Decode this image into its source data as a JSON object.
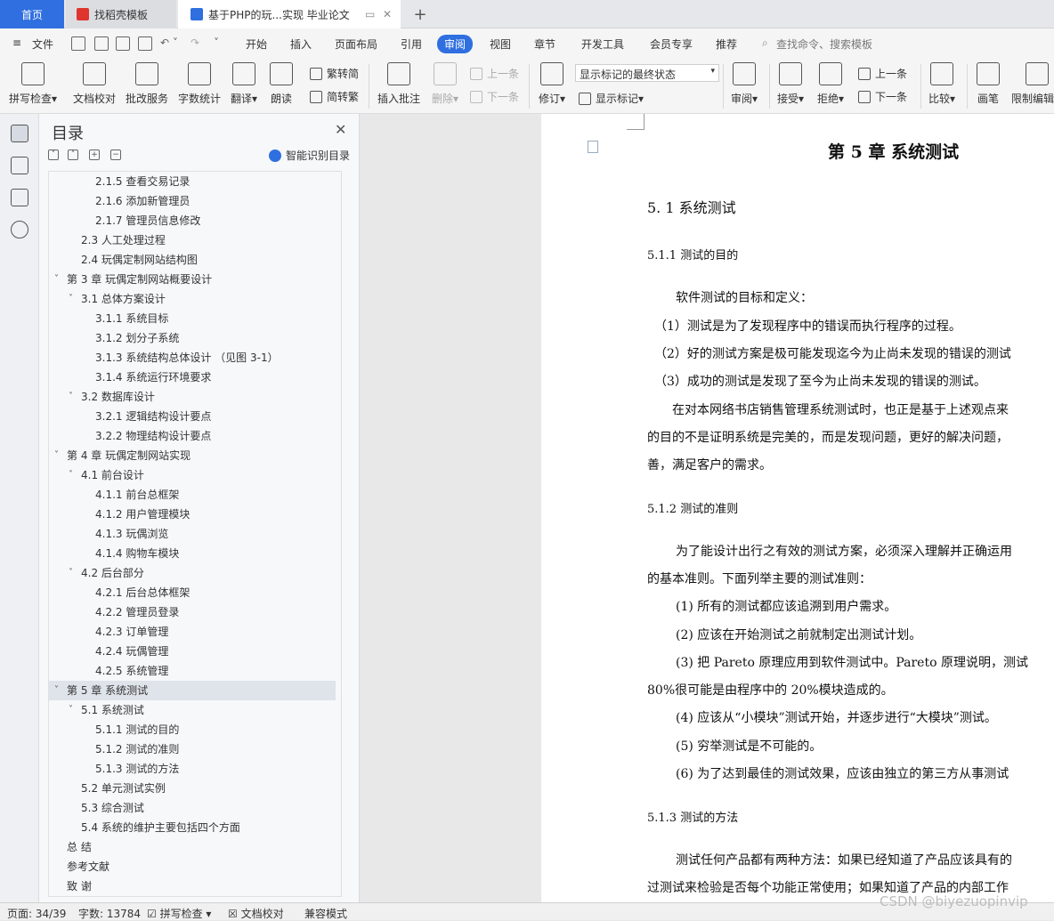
{
  "tabs": {
    "home": "首页",
    "template": "找稻壳模板",
    "doc": "基于PHP的玩...实现 毕业论文"
  },
  "menu": [
    "文件",
    "开始",
    "插入",
    "页面布局",
    "引用",
    "审阅",
    "视图",
    "章节",
    "开发工具",
    "会员专享",
    "推荐"
  ],
  "menu_active": "审阅",
  "search_placeholder": "查找命令、搜索模板",
  "ribbon": {
    "spell": "拼写检查",
    "proof": "文档校对",
    "revise_service": "批改服务",
    "wordcount": "字数统计",
    "translate": "翻译",
    "read": "朗读",
    "to_trad": "繁转简",
    "to_simp": "简转繁",
    "insert_comment": "插入批注",
    "delete": "删除",
    "prev1": "上一条",
    "next1": "下一条",
    "track": "修订",
    "markup_select": "显示标记的最终状态",
    "show_markup": "显示标记",
    "review": "审阅",
    "accept": "接受",
    "reject": "拒绝",
    "prev2": "上一条",
    "next2": "下一条",
    "compare": "比较",
    "pen": "画笔",
    "restrict": "限制编辑"
  },
  "toc": {
    "title": "目录",
    "smart": "智能识别目录",
    "items": [
      {
        "text": "2.1.5 查看交易记录",
        "level": 3
      },
      {
        "text": "2.1.6 添加新管理员",
        "level": 3
      },
      {
        "text": "2.1.7 管理员信息修改",
        "level": 3
      },
      {
        "text": "2.3 人工处理过程",
        "level": 2
      },
      {
        "text": "2.4 玩偶定制网站结构图",
        "level": 2
      },
      {
        "text": "第 3 章  玩偶定制网站概要设计",
        "level": 1,
        "caret": true
      },
      {
        "text": "3.1 总体方案设计",
        "level": 2,
        "caret": true
      },
      {
        "text": "3.1.1  系统目标",
        "level": 3
      },
      {
        "text": "3.1.2  划分子系统",
        "level": 3
      },
      {
        "text": "3.1.3  系统结构总体设计  （见图 3-1）",
        "level": 3
      },
      {
        "text": "3.1.4  系统运行环境要求",
        "level": 3
      },
      {
        "text": "3.2  数据库设计",
        "level": 2,
        "caret": true
      },
      {
        "text": "3.2.1 逻辑结构设计要点",
        "level": 3
      },
      {
        "text": "3.2.2 物理结构设计要点",
        "level": 3
      },
      {
        "text": "第 4 章  玩偶定制网站实现",
        "level": 1,
        "caret": true
      },
      {
        "text": "4.1  前台设计",
        "level": 2,
        "caret": true
      },
      {
        "text": "4.1.1  前台总框架",
        "level": 3
      },
      {
        "text": "4.1.2  用户管理模块",
        "level": 3
      },
      {
        "text": "4.1.3  玩偶浏览",
        "level": 3
      },
      {
        "text": "4.1.4  购物车模块",
        "level": 3
      },
      {
        "text": "4.2  后台部分",
        "level": 2,
        "caret": true
      },
      {
        "text": "4.2.1  后台总体框架",
        "level": 3
      },
      {
        "text": "4.2.2  管理员登录",
        "level": 3
      },
      {
        "text": "4.2.3  订单管理",
        "level": 3
      },
      {
        "text": "4.2.4  玩偶管理",
        "level": 3
      },
      {
        "text": "4.2.5  系统管理",
        "level": 3
      },
      {
        "text": "第 5 章  系统测试",
        "level": 1,
        "caret": true,
        "selected": true
      },
      {
        "text": "5.1 系统测试",
        "level": 2,
        "caret": true
      },
      {
        "text": "5.1.1 测试的目的",
        "level": 3
      },
      {
        "text": "5.1.2 测试的准则",
        "level": 3
      },
      {
        "text": "5.1.3 测试的方法",
        "level": 3
      },
      {
        "text": "5.2 单元测试实例",
        "level": 2
      },
      {
        "text": "5.3 综合测试",
        "level": 2
      },
      {
        "text": "5.4 系统的维护主要包括四个方面",
        "level": 2
      },
      {
        "text": "总    结",
        "level": 1
      },
      {
        "text": "参考文献",
        "level": 1
      },
      {
        "text": "致    谢",
        "level": 1
      }
    ]
  },
  "doc": {
    "chapter": "第 5 章  系统测试",
    "s51": "5. 1 系统测试",
    "s511": "5.1.1 测试的目的",
    "p1": "软件测试的目标和定义：",
    "p2": "（1）测试是为了发现程序中的错误而执行程序的过程。",
    "p3": "（2）好的测试方案是极可能发现迄今为止尚未发现的错误的测试",
    "p4": "（3）成功的测试是发现了至今为止尚未发现的错误的测试。",
    "p5": "在对本网络书店销售管理系统测试时，也正是基于上述观点来",
    "p6": "的目的不是证明系统是完美的，而是发现问题，更好的解决问题，",
    "p7": "善，满足客户的需求。",
    "s512": "5.1.2 测试的准则",
    "p8": "为了能设计出行之有效的测试方案，必须深入理解并正确运用",
    "p9": "的基本准则。下面列举主要的测试准则：",
    "p10": "(1)  所有的测试都应该追溯到用户需求。",
    "p11": "(2)  应该在开始测试之前就制定出测试计划。",
    "p12": "(3)  把 Pareto 原理应用到软件测试中。Pareto 原理说明，测试",
    "p13": "80%很可能是由程序中的 20%模块造成的。",
    "p14": "(4)  应该从“小模块”测试开始，并逐步进行“大模块”测试。",
    "p15": "(5)  穷举测试是不可能的。",
    "p16": "(6)  为了达到最佳的测试效果，应该由独立的第三方从事测试",
    "s513": "5.1.3 测试的方法",
    "p17": "测试任何产品都有两种方法：如果已经知道了产品应该具有的",
    "p18": "过测试来检验是否每个功能正常使用；如果知道了产品的内部工作"
  },
  "status": {
    "page": "页面: 34/39",
    "words": "字数: 13784",
    "spell": "拼写检查",
    "proof": "文档校对",
    "compat": "兼容模式"
  },
  "watermark": "CSDN @biyezuopinvip",
  "colors": {
    "accent": "#2f6fe0",
    "tab_bg": "#e6e7ea",
    "toc_bg": "#f7f8fa",
    "toc_selected": "#dfe3ea"
  }
}
